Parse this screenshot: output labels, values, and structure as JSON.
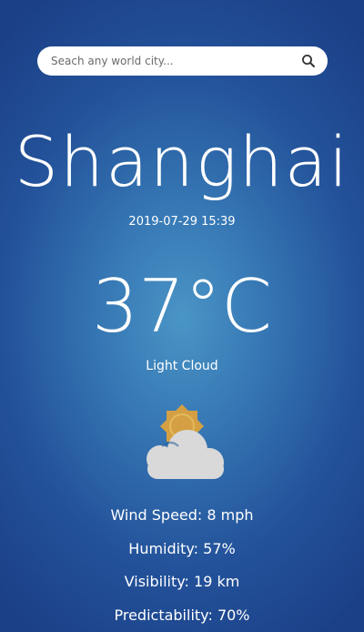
{
  "search": {
    "placeholder": "Seach any world city..."
  },
  "weather": {
    "city": "Shanghai",
    "datetime": "2019-07-29 15:39",
    "temperature": "37°C",
    "condition": "Light Cloud",
    "icon": "light-cloud-icon"
  },
  "stats": {
    "wind_speed": "Wind Speed: 8 mph",
    "humidity": "Humidity: 57%",
    "visibility": "Visibility: 19 km",
    "predictability": "Predictability: 70%"
  },
  "colors": {
    "background_center": "#4a95c6",
    "background_edge": "#1b3f86",
    "sun": "#d4a043",
    "cloud": "#d9d9d9",
    "text": "#ffffff"
  }
}
